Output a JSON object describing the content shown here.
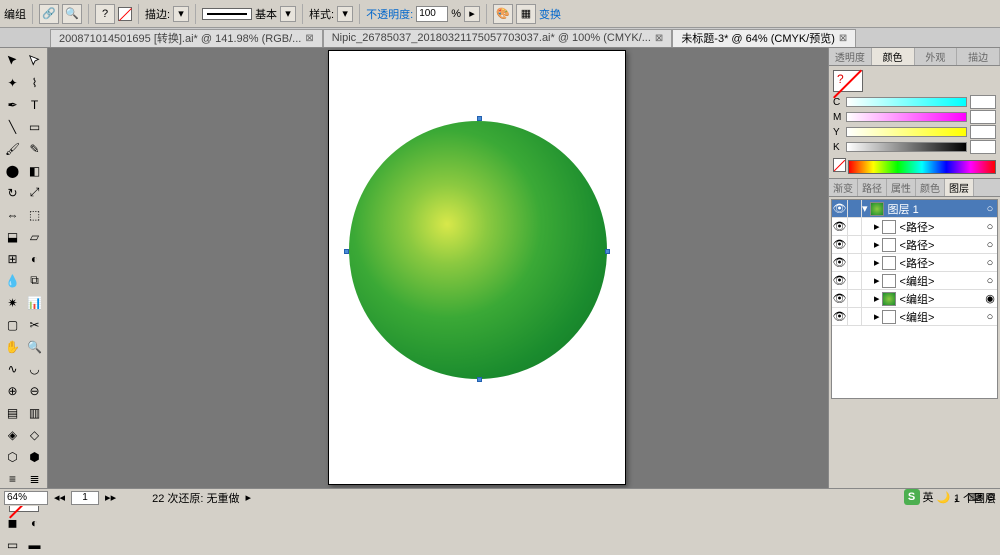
{
  "topbar": {
    "group_label": "编组",
    "stroke_label": "描边:",
    "basic_label": "基本",
    "style_label": "样式:",
    "opacity_label": "不透明度:",
    "opacity_value": "100",
    "opacity_unit": "%",
    "transform_label": "变换"
  },
  "tabs": [
    {
      "label": "200871014501695  [转换].ai* @ 141.98% (RGB/...",
      "active": false
    },
    {
      "label": "Nipic_26785037_20180321175057703037.ai* @ 100% (CMYK/...",
      "active": false
    },
    {
      "label": "未标题-3* @ 64% (CMYK/预览)",
      "active": true
    }
  ],
  "color_panel": {
    "tabs": [
      "透明度",
      "颜色",
      "外观",
      "描边"
    ],
    "active": "颜色",
    "channels": [
      {
        "ch": "C",
        "val": ""
      },
      {
        "ch": "M",
        "val": ""
      },
      {
        "ch": "Y",
        "val": ""
      },
      {
        "ch": "K",
        "val": ""
      }
    ]
  },
  "layers_panel": {
    "tabs": [
      "渐变",
      "路径",
      "属性",
      "颜色",
      "图层"
    ],
    "active": "图层",
    "items": [
      {
        "name": "图层 1",
        "sel": true,
        "indent": 0,
        "thumb": "green",
        "target": "○"
      },
      {
        "name": "<路径>",
        "sel": false,
        "indent": 1,
        "thumb": "",
        "target": "○"
      },
      {
        "name": "<路径>",
        "sel": false,
        "indent": 1,
        "thumb": "",
        "target": "○"
      },
      {
        "name": "<路径>",
        "sel": false,
        "indent": 1,
        "thumb": "",
        "target": "○"
      },
      {
        "name": "<编组>",
        "sel": false,
        "indent": 1,
        "thumb": "",
        "target": "○"
      },
      {
        "name": "<编组>",
        "sel": false,
        "indent": 1,
        "thumb": "green",
        "target": "◉"
      },
      {
        "name": "<编组>",
        "sel": false,
        "indent": 1,
        "thumb": "",
        "target": "○"
      }
    ],
    "footer": "1 个图层"
  },
  "status": {
    "zoom": "64%",
    "page": "1",
    "history": "22 次还原: 无重做"
  },
  "ime": {
    "s": "S",
    "lang": "英"
  }
}
